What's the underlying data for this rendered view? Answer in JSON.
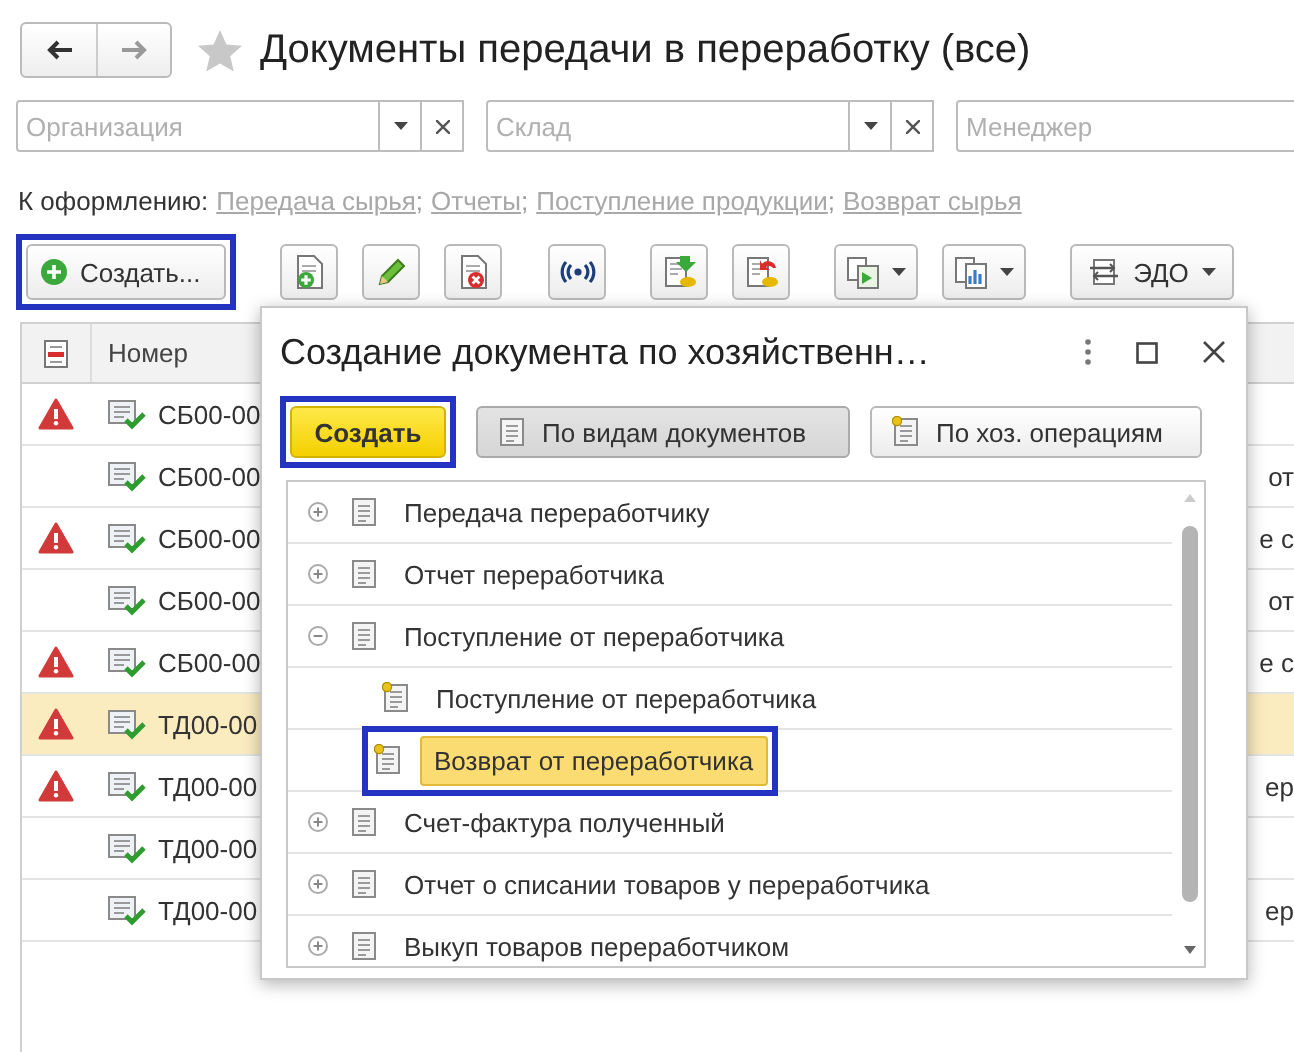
{
  "title": "Документы передачи в переработку (все)",
  "filters": [
    {
      "placeholder": "Организация"
    },
    {
      "placeholder": "Склад"
    },
    {
      "placeholder": "Менеджер"
    }
  ],
  "links": {
    "label": "К оформлению:",
    "separator": ";",
    "items": [
      "Передача сырья",
      "Отчеты",
      "Поступление продукции",
      "Возврат сырья"
    ]
  },
  "toolbar": {
    "create": {
      "label": "Создать...",
      "highlighted": true
    },
    "icon_buttons": [
      {
        "kind": "add",
        "dropdown": false
      },
      {
        "kind": "edit",
        "dropdown": false
      },
      {
        "kind": "delete",
        "dropdown": false
      },
      {
        "kind": "exchange",
        "dropdown": false
      },
      {
        "kind": "post",
        "dropdown": false
      },
      {
        "kind": "unpost",
        "dropdown": false
      },
      {
        "kind": "related",
        "dropdown": true
      },
      {
        "kind": "reports",
        "dropdown": true
      }
    ],
    "edo": {
      "label": "ЭДО",
      "dropdown": true
    }
  },
  "table": {
    "columns": [
      "Номер"
    ],
    "rows": [
      {
        "warning": true,
        "number": "СБ00-00",
        "column_3": "",
        "selected": false
      },
      {
        "warning": false,
        "number": "СБ00-00",
        "column_3": "от",
        "selected": false
      },
      {
        "warning": true,
        "number": "СБ00-00",
        "column_3": "е с",
        "selected": false
      },
      {
        "warning": false,
        "number": "СБ00-00",
        "column_3": "от",
        "selected": false
      },
      {
        "warning": true,
        "number": "СБ00-00",
        "column_3": "е с",
        "selected": false
      },
      {
        "warning": true,
        "number": "ТД00-00",
        "column_3": "",
        "selected": true
      },
      {
        "warning": true,
        "number": "ТД00-00",
        "column_3": "ер",
        "selected": false
      },
      {
        "warning": false,
        "number": "ТД00-00",
        "column_3": "",
        "selected": false
      },
      {
        "warning": false,
        "number": "ТД00-00",
        "column_3": "ер",
        "selected": false
      }
    ]
  },
  "dialog": {
    "title": "Создание документа по хозяйственн…",
    "create": {
      "label": "Создать",
      "highlighted": true
    },
    "modes": [
      {
        "label": "По видам документов",
        "selected": true
      },
      {
        "label": "По хоз. операциям",
        "selected": false
      }
    ],
    "tree": [
      {
        "label": "Передача переработчику",
        "kind": "document",
        "expanded": false,
        "selected": false
      },
      {
        "label": "Отчет переработчика",
        "kind": "document",
        "expanded": false,
        "selected": false
      },
      {
        "label": "Поступление от переработчика",
        "kind": "document",
        "expanded": true,
        "selected": false,
        "children": [
          {
            "label": "Поступление от переработчика",
            "kind": "operation",
            "selected": false,
            "highlighted": false
          },
          {
            "label": "Возврат от переработчика",
            "kind": "operation",
            "selected": true,
            "highlighted": true
          }
        ]
      },
      {
        "label": "Счет-фактура полученный",
        "kind": "document",
        "expanded": false,
        "selected": false
      },
      {
        "label": "Отчет о списании товаров у переработчика",
        "kind": "document",
        "expanded": false,
        "selected": false
      },
      {
        "label": "Выкуп товаров переработчиком",
        "kind": "document",
        "expanded": false,
        "selected": false
      }
    ]
  }
}
